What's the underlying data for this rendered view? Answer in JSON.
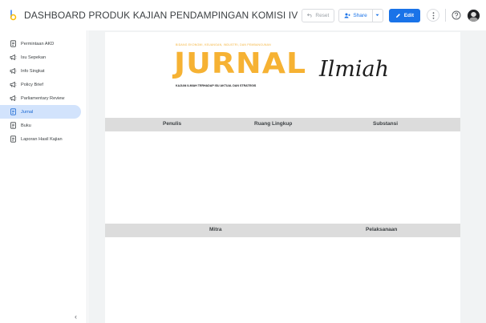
{
  "header": {
    "title": "DASHBOARD PRODUK KAJIAN PENDAMPINGAN KOMISI IV",
    "reset_label": "Reset",
    "share_label": "Share",
    "edit_label": "Edit"
  },
  "sidebar": {
    "items": [
      {
        "label": "Permintaan AKD",
        "icon": "document-icon",
        "active": false
      },
      {
        "label": "Isu Sepekan",
        "icon": "megaphone-icon",
        "active": false
      },
      {
        "label": "Info Singkat",
        "icon": "megaphone-icon",
        "active": false
      },
      {
        "label": "Policy Brief",
        "icon": "megaphone-icon",
        "active": false
      },
      {
        "label": "Parliamentary Review",
        "icon": "megaphone-icon",
        "active": false
      },
      {
        "label": "Jurnal",
        "icon": "document-icon",
        "active": true
      },
      {
        "label": "Buku",
        "icon": "document-icon",
        "active": false
      },
      {
        "label": "Laporan Hasil Kajian",
        "icon": "document-icon",
        "active": false
      }
    ],
    "collapse_glyph": "‹"
  },
  "report": {
    "brand": {
      "tagline_top": "BIDANG EKONOMI, KEUANGAN, INDUSTRI, DAN PEMBANGUNAN",
      "word": "JURNAL",
      "script": "Ilmiah",
      "tagline_bottom": "KAJIAN ILMIAH TERHADAP ISU AKTUAL DAN STRATEGIS",
      "accent_color": "#f6b233"
    },
    "table1_headers": [
      "Penulis",
      "Ruang Lingkup",
      "Substansi"
    ],
    "table2_headers": [
      "Mitra",
      "Pelaksanaan"
    ]
  },
  "colors": {
    "accent_blue": "#1a73e8",
    "active_nav_bg": "#d2e3fc",
    "table_header_bg": "#dcdcdc",
    "canvas_bg": "#f1f3f4"
  }
}
